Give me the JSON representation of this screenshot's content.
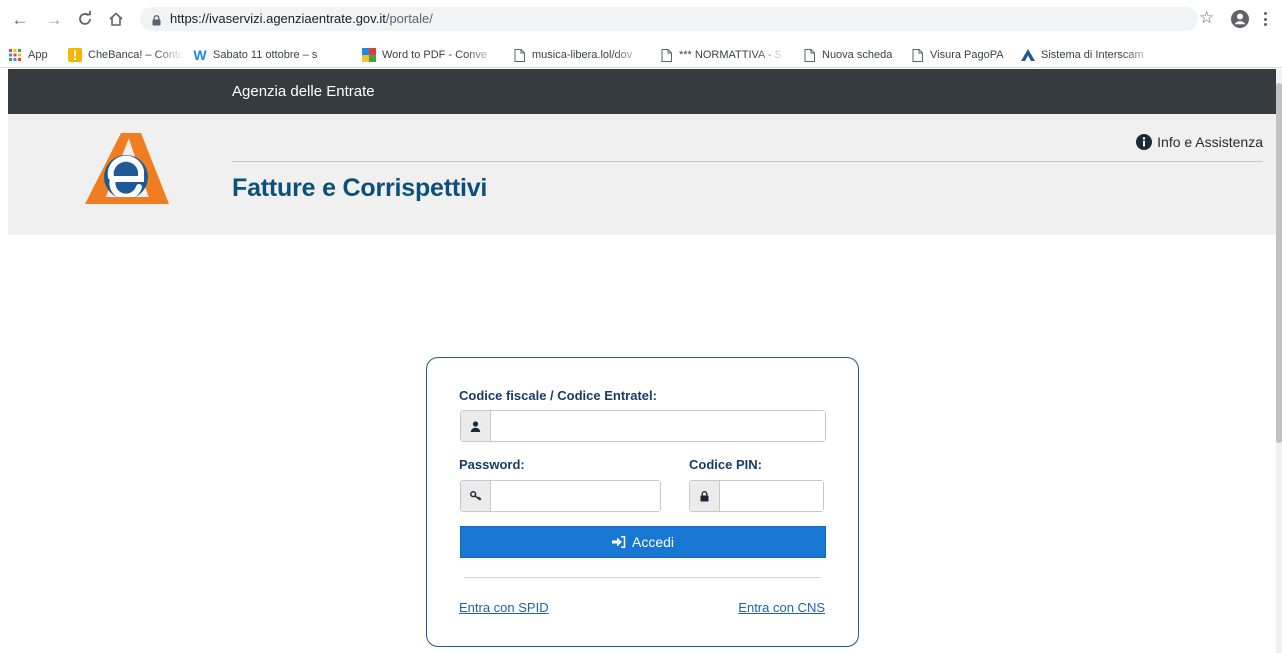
{
  "browser": {
    "url_host": "https://ivaservizi.agenziaentrate.gov.it",
    "url_path": "/portale/",
    "bookmarks": [
      {
        "label": "App",
        "icon": "apps-grid-icon"
      },
      {
        "label": "CheBanca! – Conto C",
        "icon": "chebanca-icon"
      },
      {
        "label": "Sabato 11 ottobre – s",
        "icon": "w-logo-icon"
      },
      {
        "label": "Word to PDF - Conve",
        "icon": "word-to-pdf-icon"
      },
      {
        "label": "musica-libera.lol/dov",
        "icon": "page-icon"
      },
      {
        "label": "*** NORMATTIVA - S",
        "icon": "page-icon"
      },
      {
        "label": "Nuova scheda",
        "icon": "page-icon"
      },
      {
        "label": "Visura PagoPA",
        "icon": "page-icon"
      },
      {
        "label": "Sistema di Interscam",
        "icon": "triangle-logo-icon"
      }
    ]
  },
  "site": {
    "topbar_title": "Agenzia delle Entrate",
    "info_label": "Info e Assistenza",
    "app_title": "Fatture e Corrispettivi"
  },
  "login": {
    "codice_fiscale_label": "Codice fiscale / Codice Entratel:",
    "codice_fiscale_value": "",
    "password_label": "Password:",
    "password_value": "",
    "pin_label": "Codice PIN:",
    "pin_value": "",
    "submit_label": "Accedi",
    "spid_link": "Entra con SPID",
    "cns_link": "Entra con CNS"
  },
  "colors": {
    "topbar": "#363b3f",
    "header_bg": "#f0f0f0",
    "title_blue": "#0b4f7c",
    "button_blue": "#1777d3",
    "link_blue": "#1b64a8",
    "logo_orange": "#f07d22",
    "logo_blue": "#1e5a96"
  }
}
